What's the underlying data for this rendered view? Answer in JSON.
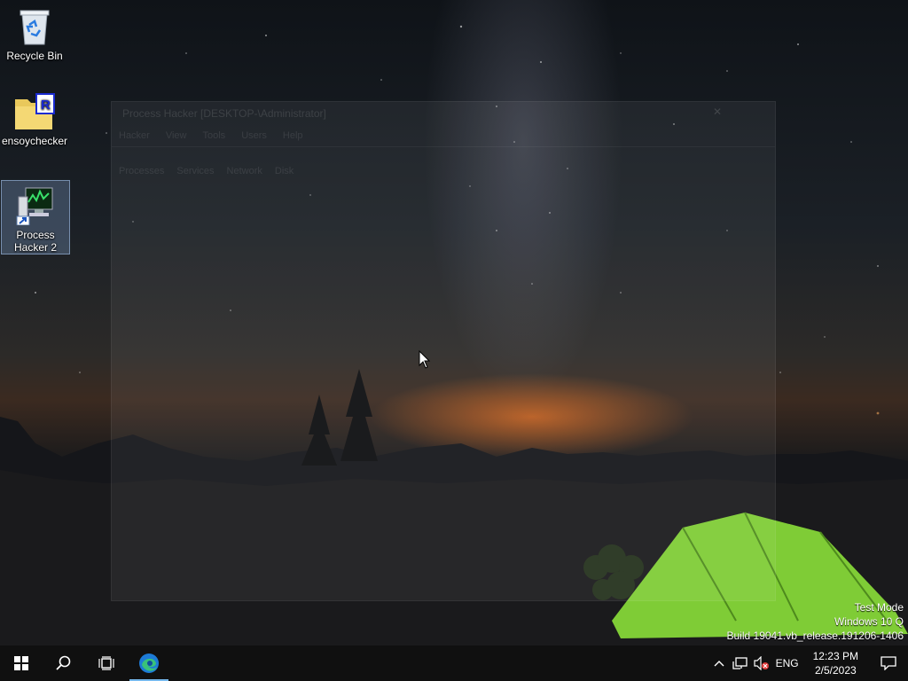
{
  "desktop": {
    "icons": [
      {
        "label": "Recycle Bin"
      },
      {
        "label": "ensoychecker"
      },
      {
        "label": "Process Hacker 2"
      }
    ]
  },
  "ghost_window": {
    "title": "Process Hacker [DESKTOP-\\Administrator]",
    "close": "✕",
    "menu": [
      "Hacker",
      "View",
      "Tools",
      "Users",
      "Help"
    ],
    "tabs": [
      "Processes",
      "Services",
      "Network",
      "Disk"
    ]
  },
  "watermark": {
    "line1": "Test Mode",
    "line2": "Windows 10 Q",
    "line3": "Build 19041.vb_release.191206-1406"
  },
  "taskbar": {
    "buttons": [
      "start",
      "search",
      "task-view",
      "edge"
    ],
    "tray": {
      "language": "ENG",
      "time": "12:23 PM",
      "date": "2/5/2023"
    }
  },
  "colors": {
    "taskbar_bg": "#101010",
    "active_indicator": "#76b9ed",
    "tent_green": "#8be03a",
    "start_icon": "#ffffff"
  }
}
